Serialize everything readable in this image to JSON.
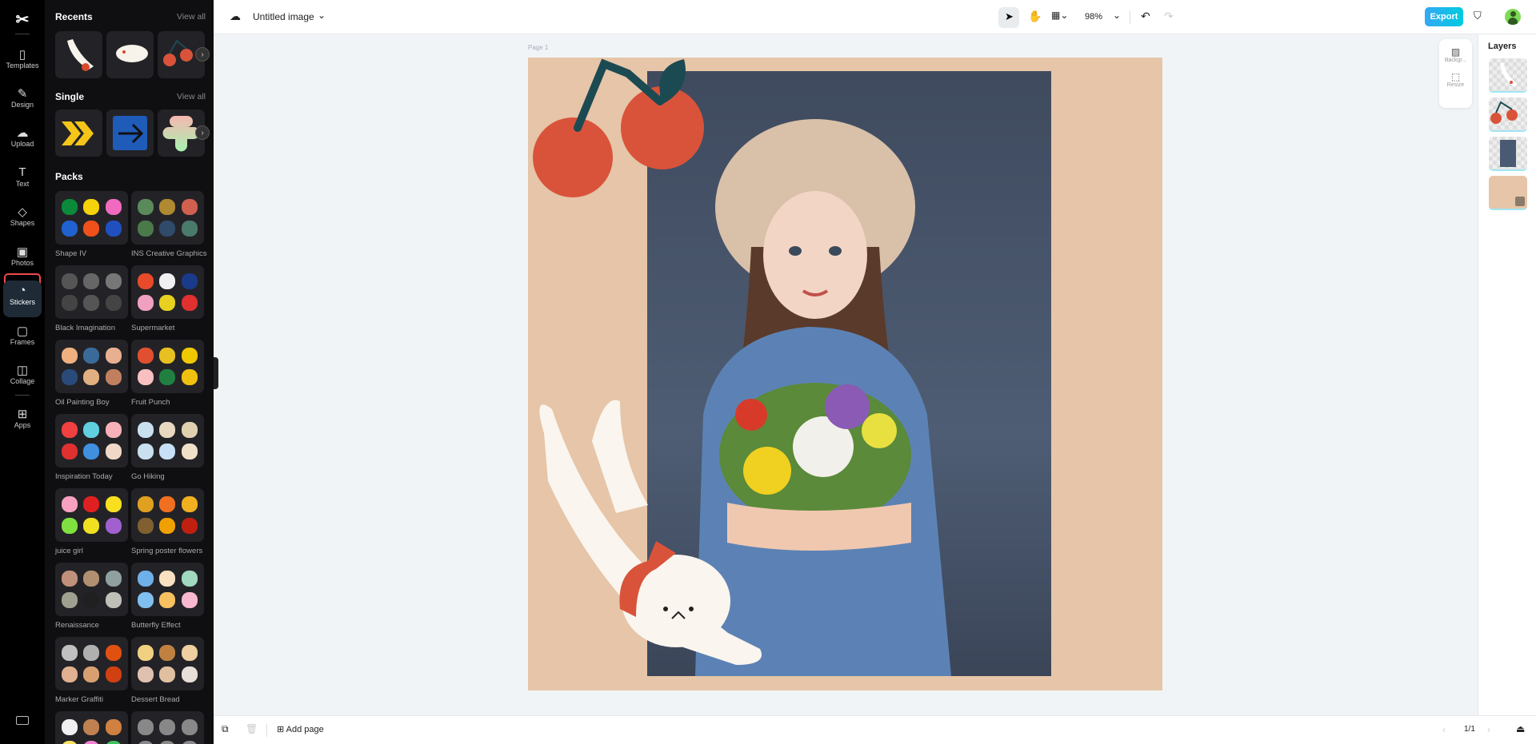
{
  "rail": {
    "items": [
      {
        "label": "Templates",
        "icon": "▯"
      },
      {
        "label": "Design",
        "icon": "✎"
      },
      {
        "label": "Upload",
        "icon": "☁"
      },
      {
        "label": "Text",
        "icon": "T"
      },
      {
        "label": "Shapes",
        "icon": "◇"
      },
      {
        "label": "Photos",
        "icon": "▣"
      },
      {
        "label": "Stickers",
        "icon": "◔"
      },
      {
        "label": "Frames",
        "icon": "▢"
      },
      {
        "label": "Collage",
        "icon": "◫"
      },
      {
        "label": "Apps",
        "icon": "⊞"
      }
    ]
  },
  "panel": {
    "recents_title": "Recents",
    "single_title": "Single",
    "packs_title": "Packs",
    "view_all": "View all",
    "packs": [
      {
        "name": "Shape IV",
        "colors": [
          "#0a8a3a",
          "#f5d20a",
          "#f06ac0",
          "#2062d0",
          "#f0501a",
          "#2050c0"
        ]
      },
      {
        "name": "INS Creative Graphics",
        "colors": [
          "#5a8a5a",
          "#b08a30",
          "#d06050",
          "#4a7a4a",
          "#304a6a",
          "#4a7a6a"
        ]
      },
      {
        "name": "Black Imagination",
        "colors": [
          "#555",
          "#666",
          "#777",
          "#444",
          "#555",
          "#444"
        ]
      },
      {
        "name": "Supermarket",
        "colors": [
          "#e84a2a",
          "#f0f0f0",
          "#1a3a8a",
          "#f0a0c0",
          "#e8d020",
          "#e03030"
        ]
      },
      {
        "name": "Oil Painting Boy",
        "colors": [
          "#f0b080",
          "#3a6a9a",
          "#e8b090",
          "#2a4a7a",
          "#e0b080",
          "#c08060"
        ]
      },
      {
        "name": "Fruit Punch",
        "colors": [
          "#e05030",
          "#e8c020",
          "#f0c800",
          "#f8c0c0",
          "#208040",
          "#f0c010"
        ]
      },
      {
        "name": "Inspiration Today",
        "colors": [
          "#f04040",
          "#60d0e0",
          "#f8b0b8",
          "#e03030",
          "#4090e0",
          "#f0d8c8"
        ]
      },
      {
        "name": "Go Hiking",
        "colors": [
          "#c8e0f0",
          "#e8d8c0",
          "#e0d0b0",
          "#c8e0f0",
          "#c8e0f8",
          "#f0e0c8"
        ]
      },
      {
        "name": "juice girl",
        "colors": [
          "#f8a0c0",
          "#e02020",
          "#f8e020",
          "#80e040",
          "#f0e020",
          "#a060d0"
        ]
      },
      {
        "name": "Spring poster flowers",
        "colors": [
          "#e0a020",
          "#f07020",
          "#f0b020",
          "#806030",
          "#f0a000",
          "#c02010"
        ]
      },
      {
        "name": "Renaissance",
        "colors": [
          "#c0907a",
          "#b09070",
          "#90a0a0",
          "#a0a090",
          "#202020",
          "#c0c0b8"
        ]
      },
      {
        "name": "Butterfly Effect",
        "colors": [
          "#70b0e8",
          "#f8e0c0",
          "#a0d8c0",
          "#80c0f0",
          "#f8c060",
          "#f8b8d0"
        ]
      },
      {
        "name": "Marker Graffiti",
        "colors": [
          "#c0c0c0",
          "#b0b0b0",
          "#e05010",
          "#e0b090",
          "#d8a070",
          "#d04010"
        ]
      },
      {
        "name": "Dessert Bread",
        "colors": [
          "#f0d080",
          "#c08040",
          "#f0d0a0",
          "#e0c0b0",
          "#e0c0a0",
          "#e8e0d8"
        ]
      },
      {
        "name": "",
        "colors": [
          "#f0f0f0",
          "#c08050",
          "#d08040",
          "#f8e060",
          "#f080d0",
          "#40c060"
        ]
      },
      {
        "name": "",
        "colors": [
          "#888",
          "#888",
          "#888",
          "#888",
          "#888",
          "#888"
        ]
      }
    ]
  },
  "topbar": {
    "title": "Untitled image",
    "zoom": "98%",
    "export": "Export"
  },
  "canvas": {
    "page_label": "Page 1",
    "bg_color": "#e6c5a8"
  },
  "float": {
    "background": "Backgr...",
    "resize": "Resize"
  },
  "layers": {
    "title": "Layers"
  },
  "bottombar": {
    "add_page": "Add page",
    "page_counter": "1/1"
  }
}
